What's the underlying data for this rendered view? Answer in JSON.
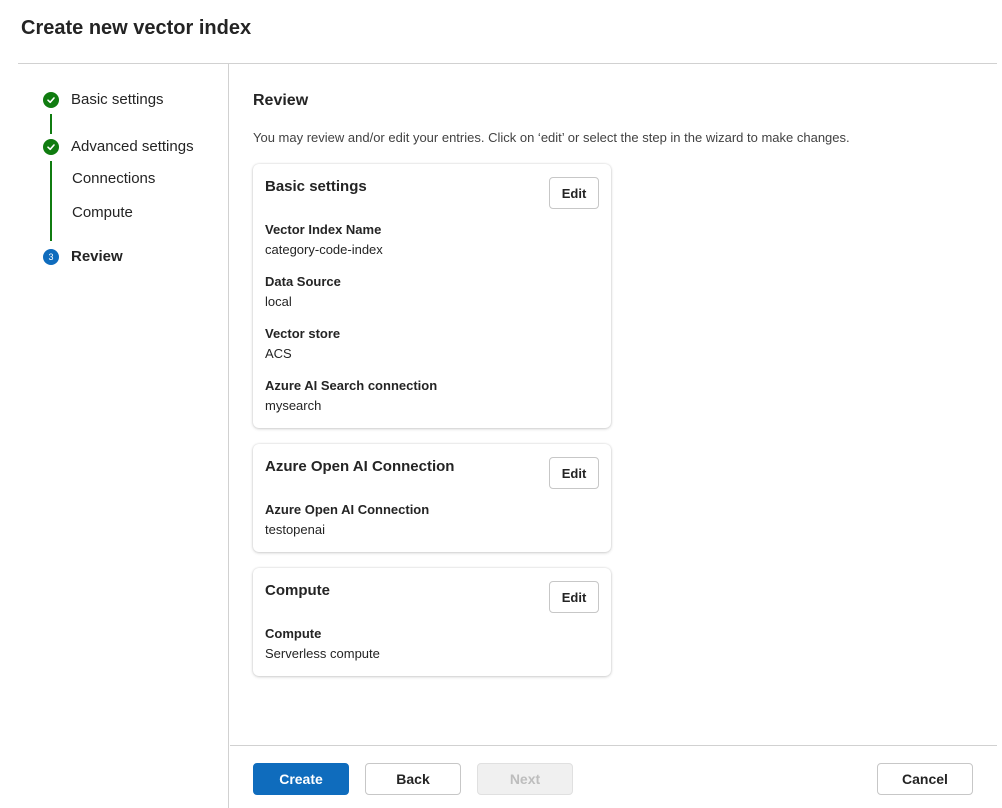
{
  "header": {
    "title": "Create new vector index"
  },
  "stepper": {
    "steps": [
      {
        "label": "Basic settings",
        "status": "completed",
        "icon": "checkmark-icon"
      },
      {
        "label": "Advanced settings",
        "status": "completed",
        "icon": "checkmark-icon",
        "substeps": [
          "Connections",
          "Compute"
        ]
      },
      {
        "label": "Review",
        "status": "current",
        "number": "3"
      }
    ],
    "colors": {
      "completed": "#107c10",
      "current": "#0f6cbd"
    }
  },
  "review": {
    "title": "Review",
    "description": "You may review and/or edit your entries. Click on ‘edit’ or select the step in the wizard to make changes.",
    "cards": [
      {
        "title": "Basic settings",
        "edit_label": "Edit",
        "fields": [
          {
            "label": "Vector Index Name",
            "value": "category-code-index"
          },
          {
            "label": "Data Source",
            "value": "local"
          },
          {
            "label": "Vector store",
            "value": "ACS"
          },
          {
            "label": "Azure AI Search connection",
            "value": "mysearch"
          }
        ]
      },
      {
        "title": "Azure Open AI Connection",
        "edit_label": "Edit",
        "fields": [
          {
            "label": "Azure Open AI Connection",
            "value": "testopenai"
          }
        ]
      },
      {
        "title": "Compute",
        "edit_label": "Edit",
        "fields": [
          {
            "label": "Compute",
            "value": "Serverless compute"
          }
        ]
      }
    ]
  },
  "footer": {
    "create_label": "Create",
    "back_label": "Back",
    "next_label": "Next",
    "cancel_label": "Cancel",
    "accent": "#0f6cbd"
  }
}
